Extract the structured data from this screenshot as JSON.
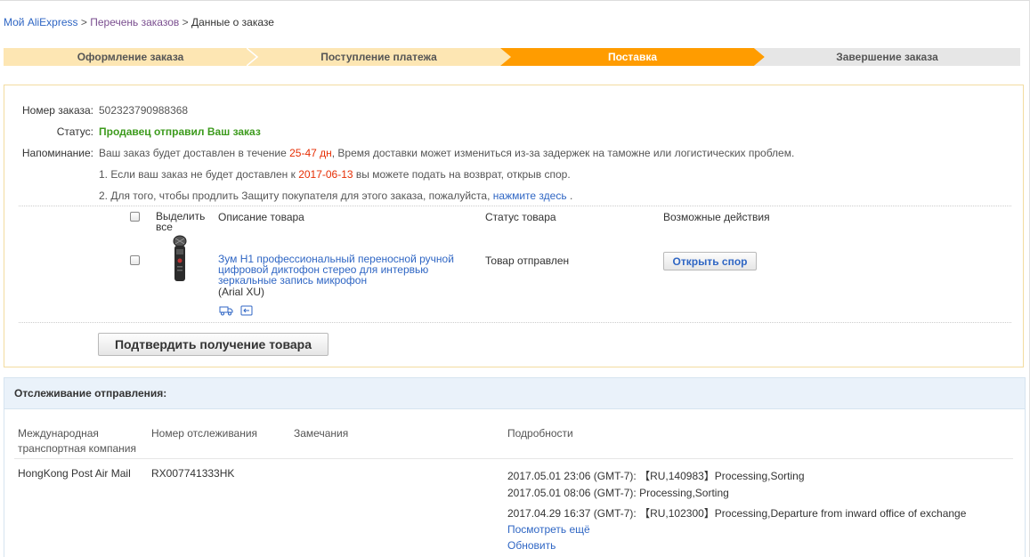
{
  "breadcrumb": {
    "my_aliexpress": "Мой AliExpress",
    "sep1": ">",
    "orders_list": "Перечень заказов",
    "sep2": ">",
    "current": "Данные о заказе"
  },
  "steps": [
    {
      "label": "Оформление заказа",
      "state": "done"
    },
    {
      "label": "Поступление платежа",
      "state": "done"
    },
    {
      "label": "Поставка",
      "state": "active"
    },
    {
      "label": "Завершение заказа",
      "state": "pending"
    }
  ],
  "colors": {
    "step_done": "#fde6b3",
    "step_active": "#ff9c00",
    "step_pending": "#e6e6e6",
    "link": "#2f66c4",
    "status_green": "#3d9b1d",
    "highlight_red": "#e62e04"
  },
  "order": {
    "number_label": "Номер заказа:",
    "number": "502323790988368",
    "status_label": "Статус:",
    "status": "Продавец отправил Ваш заказ",
    "reminder_label": "Напоминание:",
    "reminder_pre": "Ваш заказ будет доставлен в течение",
    "reminder_days": "25-47 дн",
    "reminder_post": ", Время доставки может измениться из-за задержек на таможне или логистических проблем.",
    "note1_pre": "1. Если ваш заказ не будет доставлен к",
    "note1_date": "2017-06-13",
    "note1_post": "вы можете подать на возврат, открыв спор.",
    "note2_pre": "2. Для того, чтобы продлить Защиту покупателя для этого заказа, пожалуйста,",
    "note2_link": "нажмите здесь",
    "note2_post": "."
  },
  "items_table": {
    "select_all": "Выделить все",
    "col_description": "Описание товара",
    "col_status": "Статус товара",
    "col_actions": "Возможные действия",
    "item": {
      "title": "Зум H1 профессиональный переносной ручной цифровой диктофон стерео для интервью зеркальные запись микрофон",
      "seller": "(Arial XU)",
      "status": "Товар отправлен",
      "action": "Открыть спор",
      "icons": [
        "delivery-truck-icon",
        "return-arrow-icon"
      ]
    },
    "confirm_button": "Подтвердить получение товара"
  },
  "tracking": {
    "title": "Отслеживание отправления:",
    "col_company": "Международная транспортная компания",
    "col_number": "Номер отслеживания",
    "col_remarks": "Замечания",
    "col_details": "Подробности",
    "row": {
      "company": "HongKong Post Air Mail",
      "number": "RX007741333HK",
      "remarks": "",
      "events": [
        "2017.05.01 23:06 (GMT-7): 【RU,140983】Processing,Sorting",
        "2017.05.01 08:06 (GMT-7): Processing,Sorting",
        "2017.04.29 16:37 (GMT-7): 【RU,102300】Processing,Departure from inward office of exchange"
      ],
      "more_link": "Посмотреть ещё",
      "refresh_link": "Обновить"
    }
  }
}
